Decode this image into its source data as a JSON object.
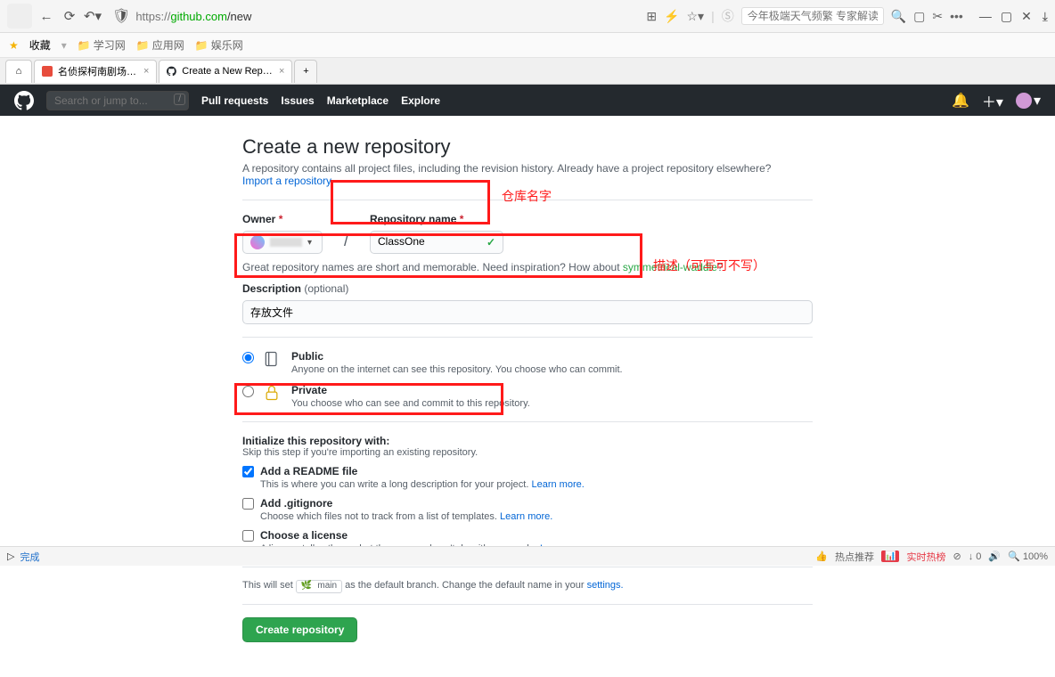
{
  "browser": {
    "url_proto": "https://",
    "url_host": "github.com",
    "url_path": "/new",
    "search_right_placeholder": "今年极端天气频繁 专家解读"
  },
  "bookmarks": {
    "fav_label": "收藏",
    "items": [
      "学习网",
      "应用网",
      "娱乐网"
    ]
  },
  "tabs": {
    "tab1": "名侦探柯南剧场版 中文版",
    "tab2": "Create a New Reposito"
  },
  "gh": {
    "search_placeholder": "Search or jump to...",
    "nav": {
      "pulls": "Pull requests",
      "issues": "Issues",
      "marketplace": "Marketplace",
      "explore": "Explore"
    }
  },
  "page": {
    "title": "Create a new repository",
    "subtitle_a": "A repository contains all project files, including the revision history. Already have a project repository elsewhere?",
    "import_link": "Import a repository.",
    "owner_label": "Owner",
    "repo_label": "Repository name",
    "repo_value": "ClassOne",
    "hint_a": "Great repository names are short and memorable. Need inspiration? How about ",
    "hint_link": "symmetrical-waddle",
    "desc_label": "Description",
    "desc_optional": "(optional)",
    "desc_value": "存放文件",
    "public_title": "Public",
    "public_sub": "Anyone on the internet can see this repository. You choose who can commit.",
    "private_title": "Private",
    "private_sub": "You choose who can see and commit to this repository.",
    "init_heading": "Initialize this repository with:",
    "init_sub": "Skip this step if you're importing an existing repository.",
    "readme_title": "Add a README file",
    "readme_sub": "This is where you can write a long description for your project. ",
    "gitignore_title": "Add .gitignore",
    "gitignore_sub": "Choose which files not to track from a list of templates. ",
    "license_title": "Choose a license",
    "license_sub": "A license tells others what they can and can't do with your code. ",
    "learn_more": "Learn more.",
    "branch_a": "This will set ",
    "branch_name": "main",
    "branch_b": " as the default branch. Change the default name in your ",
    "branch_link": "settings.",
    "create_btn": "Create repository"
  },
  "annotations": {
    "repo_name": "仓库名字",
    "description": "描述（可写可不写）"
  },
  "status": {
    "left": "完成",
    "hot_rec": "热点推荐",
    "hot_live": "实时热榜",
    "speed": "0",
    "zoom": "100%"
  }
}
